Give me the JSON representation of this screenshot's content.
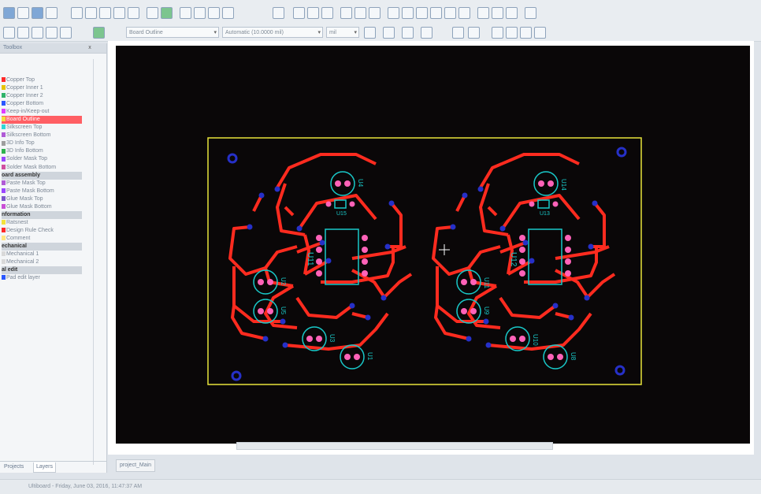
{
  "toolbar": {
    "layer_combo": "Board Outline",
    "grid_combo": "Automatic (10.0000 mil)",
    "unit_combo": "mil"
  },
  "panel": {
    "title": "Toolbox",
    "close_glyph": "x",
    "layers": [
      {
        "label": "Copper Top",
        "color": "#ff2a2a",
        "group": false
      },
      {
        "label": "Copper Inner 1",
        "color": "#e6c300",
        "group": false
      },
      {
        "label": "Copper Inner 2",
        "color": "#2fb36a",
        "group": false
      },
      {
        "label": "Copper Bottom",
        "color": "#2a57ff",
        "group": false
      },
      {
        "label": "Keep-in/Keep-out",
        "color": "#e03cff",
        "group": false
      },
      {
        "label": "Board Outline",
        "color": "#f2e23b",
        "group": false,
        "selected": true
      },
      {
        "label": "Silkscreen Top",
        "color": "#32d6d6",
        "group": false
      },
      {
        "label": "Silkscreen Bottom",
        "color": "#b05bd6",
        "group": false
      },
      {
        "label": "3D Info Top",
        "color": "#9e9e9e",
        "group": false
      },
      {
        "label": "3D Info Bottom",
        "color": "#2fb34f",
        "group": false
      },
      {
        "label": "Solder Mask Top",
        "color": "#9a46ff",
        "group": false
      },
      {
        "label": "Solder Mask Bottom",
        "color": "#d04fa0",
        "group": false
      },
      {
        "label": "oard assembly",
        "color": "",
        "group": true
      },
      {
        "label": "Paste Mask Top",
        "color": "#b05bd6",
        "group": false
      },
      {
        "label": "Paste Mask Bottom",
        "color": "#9a46ff",
        "group": false
      },
      {
        "label": "Glue Mask Top",
        "color": "#7b57c9",
        "group": false
      },
      {
        "label": "Glue Mask Bottom",
        "color": "#c94fd6",
        "group": false
      },
      {
        "label": "nformation",
        "color": "",
        "group": true
      },
      {
        "label": "Ratsnest",
        "color": "#f2e23b",
        "group": false
      },
      {
        "label": "Design Rule Check",
        "color": "#ff2a2a",
        "group": false
      },
      {
        "label": "Comment",
        "color": "#ffe680",
        "group": false
      },
      {
        "label": "echanical",
        "color": "",
        "group": true
      },
      {
        "label": "Mechanical 1",
        "color": "#d9d9d9",
        "group": false
      },
      {
        "label": "Mechanical 2",
        "color": "#d9d9d9",
        "group": false
      },
      {
        "label": "al edit",
        "color": "",
        "group": true
      },
      {
        "label": "Pad edit layer",
        "color": "#2a57ff",
        "group": false
      }
    ],
    "tabs": [
      "Projects",
      "Layers"
    ]
  },
  "document_tab": "project_Main",
  "status_text": "Ultiboard  -  Friday, June 03, 2016, 11:47:37 AM",
  "board": {
    "left_circuit": {
      "ic": "U11",
      "ic2": "U15",
      "leds": [
        "U4",
        "U2",
        "U5",
        "U3",
        "U1"
      ]
    },
    "right_circuit": {
      "ic": "U12",
      "ic2": "U13",
      "leds": [
        "U14",
        "U11",
        "U9",
        "U10",
        "U8"
      ]
    }
  },
  "colors": {
    "copper": "#ff2b1f",
    "silkscreen": "#19c9c9",
    "outline": "#e8e43a",
    "pad": "#ff62b8",
    "via": "#2630c8",
    "background": "#0a0708"
  }
}
